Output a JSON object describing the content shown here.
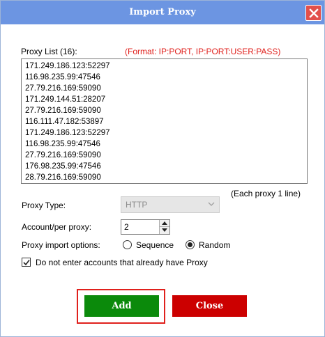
{
  "window": {
    "title": "Import Proxy",
    "close_icon": "close-icon",
    "titlebar_color": "#6c95e2",
    "close_color": "#e2504b"
  },
  "proxy_list": {
    "label": "Proxy List (16):",
    "format_hint": "(Format: IP:PORT, IP:PORT:USER:PASS)",
    "format_color": "#e0201c",
    "lines": [
      "171.249.186.123:52297",
      "116.98.235.99:47546",
      "27.79.216.169:59090",
      "171.249.144.51:28207",
      "27.79.216.169:59090",
      "116.111.47.182:53897",
      "171.249.186.123:52297",
      "116.98.235.99:47546",
      "27.79.216.169:59090",
      "176.98.235.99:47546",
      "28.79.216.169:59090"
    ],
    "note": "(Each proxy 1 line)"
  },
  "proxy_type": {
    "label": "Proxy Type:",
    "value": "HTTP"
  },
  "account_per_proxy": {
    "label": "Account/per proxy:",
    "value": "2"
  },
  "import_options": {
    "label": "Proxy import options:",
    "options": [
      "Sequence",
      "Random"
    ],
    "selected": "Random"
  },
  "skip_existing": {
    "label": "Do not enter accounts that already have Proxy",
    "checked": true
  },
  "buttons": {
    "add": "Add",
    "close": "Close",
    "add_color": "#0b8a0b",
    "close_color": "#cc0000",
    "highlight_color": "#e0201c"
  }
}
